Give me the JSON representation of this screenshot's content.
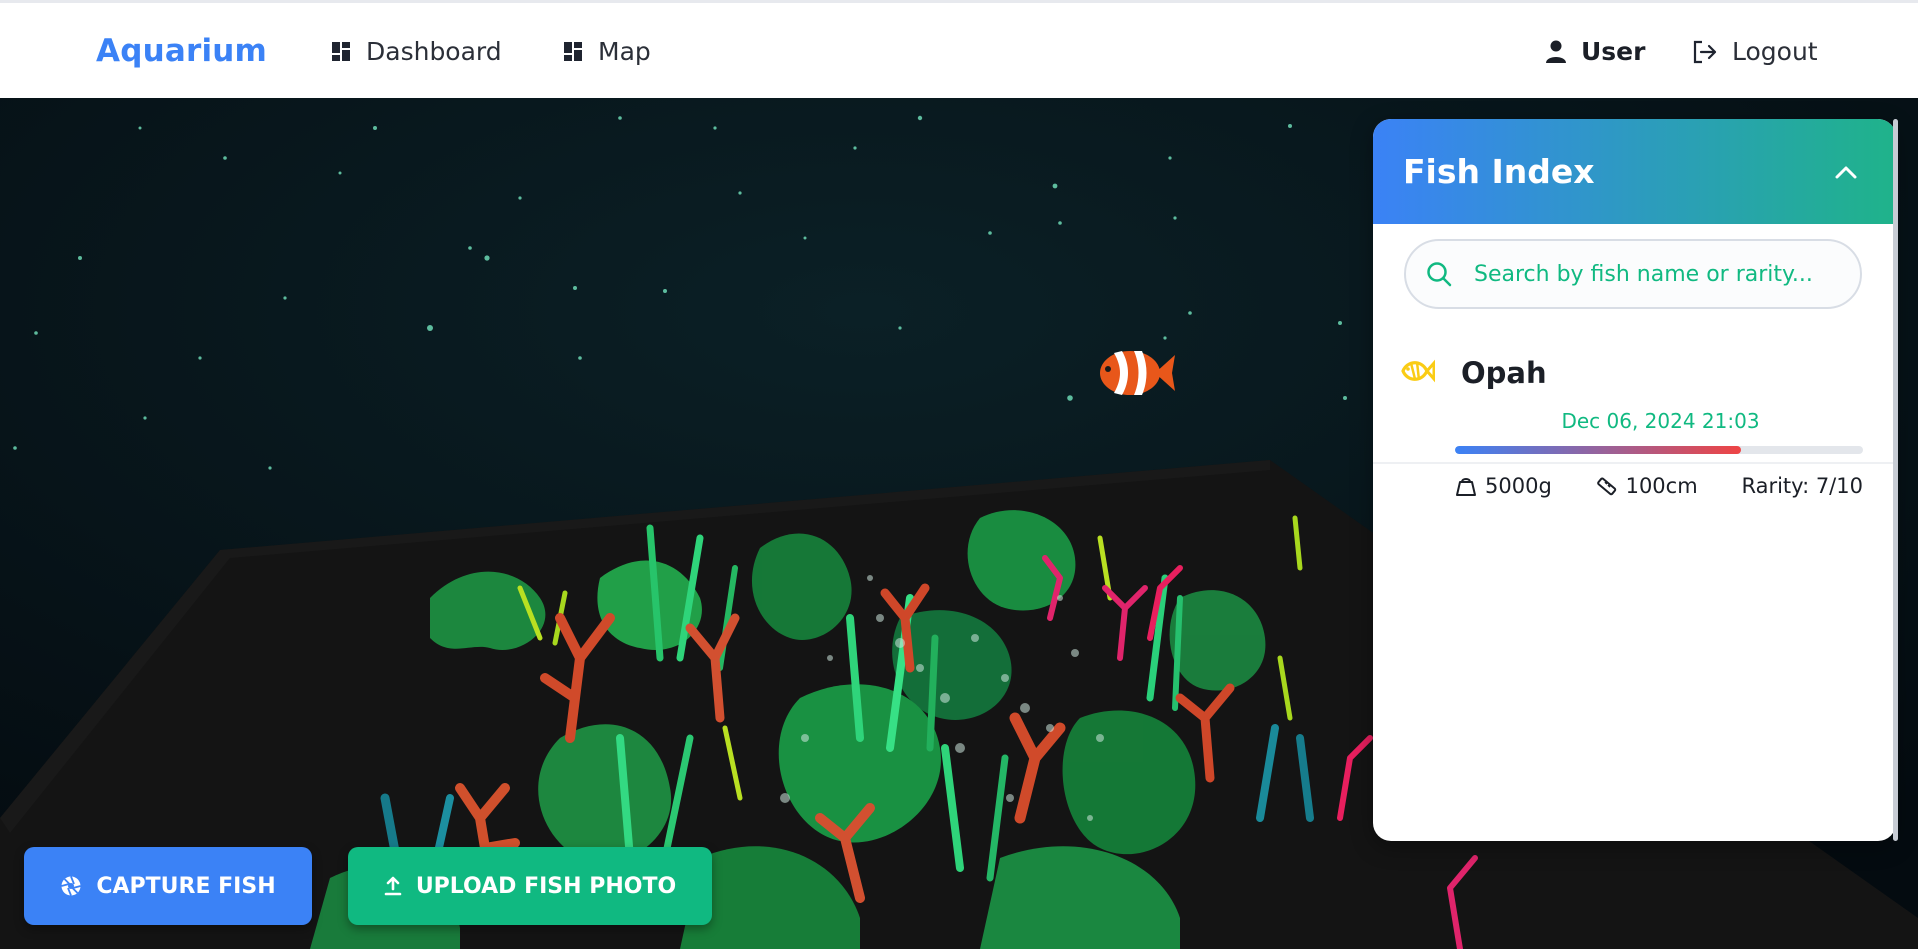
{
  "nav": {
    "brand": "Aquarium",
    "links": [
      {
        "label": "Dashboard",
        "icon": "dashboard-icon"
      },
      {
        "label": "Map",
        "icon": "dashboard-icon"
      }
    ],
    "user_label": "User",
    "logout_label": "Logout"
  },
  "fish_index": {
    "title": "Fish Index",
    "search_placeholder": "Search by fish name or rarity...",
    "items": [
      {
        "name": "Opah",
        "date": "Dec 06, 2024 21:03",
        "weight": "5000g",
        "length": "100cm",
        "rarity_label": "Rarity: 7/10",
        "rarity_fraction": 0.7,
        "icon": "fish-icon"
      }
    ]
  },
  "actions": {
    "capture_label": "CAPTURE FISH",
    "upload_label": "UPLOAD FISH PHOTO"
  },
  "colors": {
    "brand": "#3b82f6",
    "accent_green": "#10b981",
    "fish_icon": "#facc15"
  }
}
